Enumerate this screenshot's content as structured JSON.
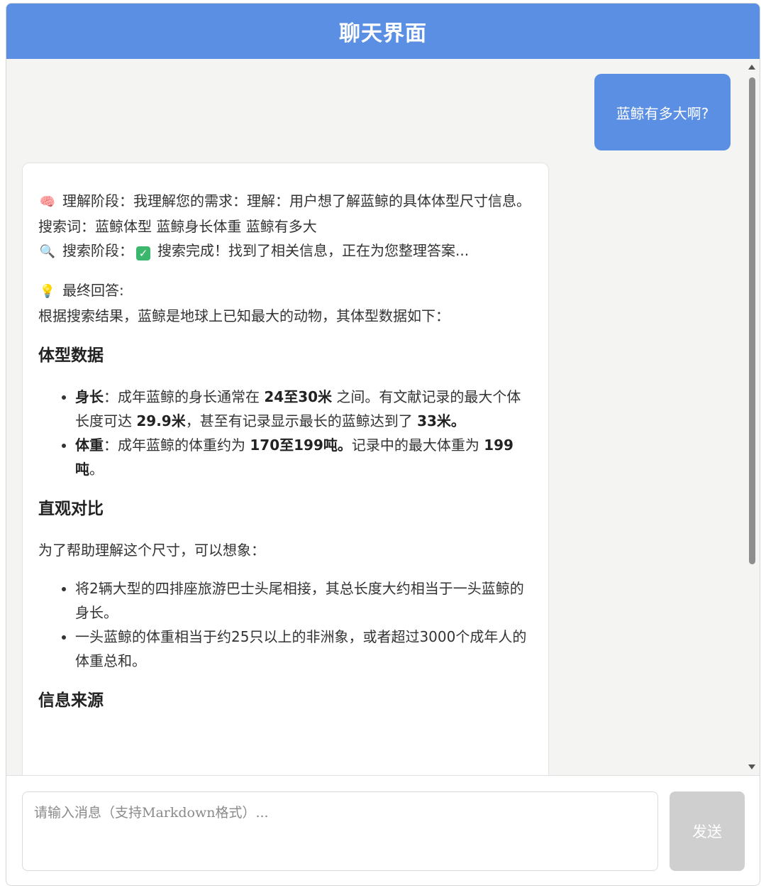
{
  "header": {
    "title": "聊天界面"
  },
  "messages": {
    "user": {
      "text": "蓝鲸有多大啊?"
    },
    "bot": {
      "understanding": {
        "icon": "brain-icon",
        "text": "理解阶段：我理解您的需求：理解：用户想了解蓝鲸的具体体型尺寸信息。"
      },
      "keywords": "搜索词：蓝鲸体型 蓝鲸身长体重 蓝鲸有多大",
      "search": {
        "icon": "magnifier-icon",
        "label": "搜索阶段：",
        "check_icon": "check-icon",
        "text": "搜索完成！找到了相关信息，正在为您整理答案..."
      },
      "final": {
        "icon": "lightbulb-icon",
        "label": "最终回答:"
      },
      "intro": "根据搜索结果，蓝鲸是地球上已知最大的动物，其体型数据如下：",
      "section1": {
        "heading": "体型数据",
        "items": [
          {
            "term": "身长",
            "p1": "：成年蓝鲸的身长通常在 ",
            "b1": "24至30米",
            "p2": " 之间。有文献记录的最大个体长度可达 ",
            "b2": "29.9米",
            "p3": "，甚至有记录显示最长的蓝鲸达到了 ",
            "b3": "33米。"
          },
          {
            "term": "体重",
            "p1": "：成年蓝鲸的体重约为 ",
            "b1": "170至199吨。",
            "p2": "记录中的最大体重为 ",
            "b2": "199吨",
            "p3": "。"
          }
        ]
      },
      "section2": {
        "heading": "直观对比",
        "intro": "为了帮助理解这个尺寸，可以想象：",
        "items": [
          "将2辆大型的四排座旅游巴士头尾相接，其总长度大约相当于一头蓝鲸的身长。",
          "一头蓝鲸的体重相当于约25只以上的非洲象，或者超过3000个成年人的体重总和。"
        ]
      },
      "section3": {
        "heading": "信息来源"
      }
    }
  },
  "input": {
    "placeholder": "请输入消息（支持Markdown格式）...",
    "value": ""
  },
  "send_button": {
    "label": "发送"
  },
  "colors": {
    "accent": "#5b8fe3",
    "background": "#f4f4f3",
    "send_disabled": "#cfcfcf",
    "check_green": "#3bb76e"
  }
}
